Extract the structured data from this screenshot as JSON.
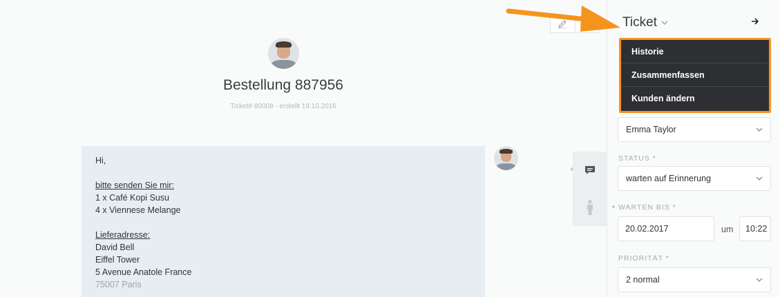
{
  "ticket": {
    "title": "Bestellung 887956",
    "meta": "Ticket# 80008 - erstellt 19.10.2016"
  },
  "article": {
    "lines": {
      "greeting": "Hi,",
      "request_heading": "bitte senden Sie mir:",
      "item1": "1 x Café Kopi Susu",
      "item2": "4 x Viennese Melange",
      "address_heading": "Lieferadresse:",
      "name": "David Bell",
      "building": "Eiffel Tower",
      "street": "5 Avenue Anatole France",
      "city": "75007 Paris"
    }
  },
  "sidebar": {
    "header": "Ticket",
    "menu": {
      "item1": "Historie",
      "item2": "Zusammenfassen",
      "item3": "Kunden ändern"
    },
    "customer_value": "Emma Taylor",
    "status_label": "STATUS *",
    "status_value": "warten auf Erinnerung",
    "pending_label": "WARTEN BIS *",
    "pending_date": "20.02.2017",
    "pending_at": "um",
    "pending_time": "10:22",
    "priority_label": "PRIORITÄT *",
    "priority_value": "2 normal"
  },
  "colors": {
    "highlight": "#f5941d",
    "menu_bg": "#2d2f33",
    "article_bg": "#e6eef3"
  },
  "icons": {
    "edit": "pencil-icon",
    "chat": "chat-bubble-icon",
    "person": "person-icon",
    "arrow": "arrow-right-icon",
    "chevron": "chevron-down-icon"
  }
}
